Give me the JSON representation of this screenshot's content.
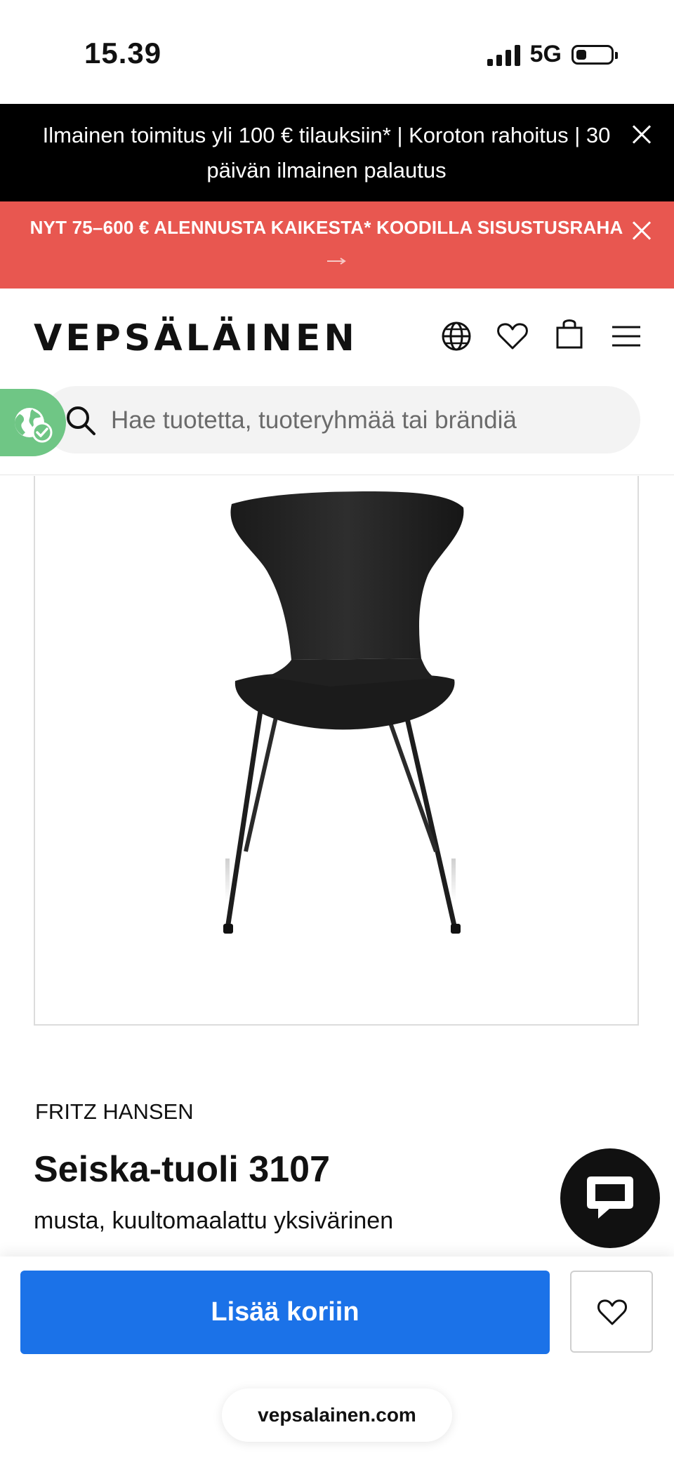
{
  "status_bar": {
    "time": "15.39",
    "network": "5G"
  },
  "banners": {
    "shipping": "Ilmainen toimitus yli 100 € tilauksiin* | Koroton rahoitus | 30 päivän ilmainen palautus",
    "promo": "NYT 75–600 € ALENNUSTA KAIKESTA* KOODILLA SISUSTUSRAHA"
  },
  "header": {
    "logo": "VEPSÄLÄINEN",
    "icons": [
      "globe-icon",
      "heart-icon",
      "shopping-bag-icon",
      "menu-icon"
    ]
  },
  "search": {
    "placeholder": "Hae tuotetta, tuoteryhmää tai brändiä"
  },
  "product": {
    "brand": "FRITZ HANSEN",
    "title": "Seiska-tuoli 3107",
    "variant": "musta, kuultomaalattu yksivärinen"
  },
  "actions": {
    "add_to_cart": "Lisää koriin"
  },
  "browser": {
    "url": "vepsalainen.com"
  },
  "colors": {
    "promo_red": "#e85750",
    "cta_blue": "#1b72e8",
    "eco_green": "#6fc685"
  }
}
